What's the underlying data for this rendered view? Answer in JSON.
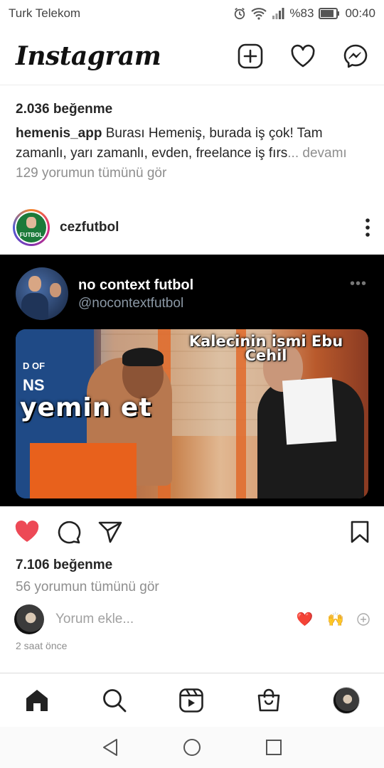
{
  "status_bar": {
    "carrier": "Turk Telekom",
    "battery_percent": "%83",
    "time": "00:40"
  },
  "header": {
    "logo": "Instagram",
    "icons": [
      "new-post-icon",
      "heart-icon",
      "messenger-icon"
    ]
  },
  "previous_post": {
    "likes": "2.036 beğenme",
    "caption_user": "hemenis_app",
    "caption_text": " Burası Hemeniş, burada iş çok! Tam zamanlı, yarı zamanlı, evden, freelance iş fırs",
    "more": "... devamı",
    "view_comments": "129 yorumun tümünü gör"
  },
  "post": {
    "username": "cezfutbol",
    "avatar_label": "FUTBOL",
    "embedded_tweet": {
      "name": "no context futbol",
      "handle": "@nocontextfutbol",
      "video_subtitle_1": "Kalecinin ismi Ebu Cehil",
      "video_subtitle_2": "yemin et",
      "video_bg_text_1": "D OF",
      "video_bg_text_2": "NS"
    },
    "liked": true,
    "likes": "7.106 beğenme",
    "view_comments": "56 yorumun tümünü gör",
    "comment_placeholder": "Yorum ekle...",
    "quick_emojis": [
      "❤️",
      "🙌"
    ],
    "time_ago": "2 saat önce"
  },
  "colors": {
    "like_red": "#ED4956",
    "muted_text": "#8E8E8E"
  },
  "bottom_nav": [
    "home-icon",
    "search-icon",
    "reels-icon",
    "shop-icon",
    "profile-avatar"
  ],
  "system_nav": [
    "back-icon",
    "home-circle-icon",
    "recents-icon"
  ]
}
